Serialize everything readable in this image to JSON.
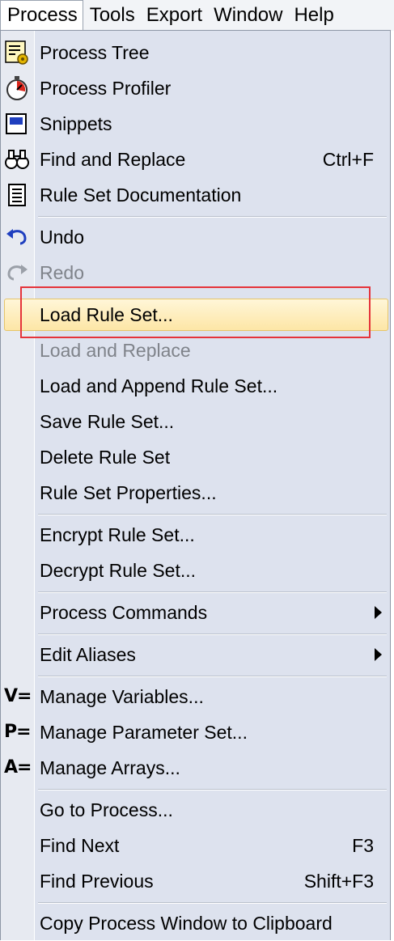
{
  "menubar": {
    "items": [
      "Process",
      "Tools",
      "Export",
      "Window",
      "Help"
    ]
  },
  "menu": {
    "items": {
      "process_tree": {
        "label": "Process Tree",
        "icon": "process-tree-icon"
      },
      "process_profiler": {
        "label": "Process Profiler",
        "icon": "stopwatch-icon"
      },
      "snippets": {
        "label": "Snippets",
        "icon": "snippet-icon"
      },
      "find_replace": {
        "label": "Find and Replace",
        "shortcut": "Ctrl+F",
        "icon": "binoculars-icon"
      },
      "rule_set_doc": {
        "label": "Rule Set Documentation",
        "icon": "document-icon"
      },
      "undo": {
        "label": "Undo",
        "icon": "undo-icon"
      },
      "redo": {
        "label": "Redo",
        "icon": "redo-icon",
        "disabled": true
      },
      "load_rule_set": {
        "label": "Load Rule Set...",
        "highlighted": true
      },
      "load_replace": {
        "label": "Load and Replace",
        "disabled": true
      },
      "load_append": {
        "label": "Load and Append Rule Set..."
      },
      "save_rule_set": {
        "label": "Save Rule Set..."
      },
      "delete_rule_set": {
        "label": "Delete Rule Set"
      },
      "rule_set_properties": {
        "label": "Rule Set Properties..."
      },
      "encrypt": {
        "label": "Encrypt Rule Set..."
      },
      "decrypt": {
        "label": "Decrypt Rule Set..."
      },
      "process_commands": {
        "label": "Process Commands",
        "submenu": true
      },
      "edit_aliases": {
        "label": "Edit Aliases",
        "submenu": true
      },
      "manage_variables": {
        "label": "Manage Variables...",
        "icon_text": "V="
      },
      "manage_parameter_set": {
        "label": "Manage Parameter Set...",
        "icon_text": "P="
      },
      "manage_arrays": {
        "label": "Manage Arrays...",
        "icon_text": "A="
      },
      "goto_process": {
        "label": "Go to Process..."
      },
      "find_next": {
        "label": "Find Next",
        "shortcut": "F3"
      },
      "find_previous": {
        "label": "Find Previous",
        "shortcut": "Shift+F3"
      },
      "copy_window": {
        "label": "Copy Process Window to Clipboard"
      }
    }
  },
  "colors": {
    "menu_bg": "#dde2ee",
    "gutter_bg": "#e7eaf1",
    "highlight_border": "#e6c56a",
    "focus_box": "#e5343b",
    "disabled_text": "#7f838a"
  }
}
